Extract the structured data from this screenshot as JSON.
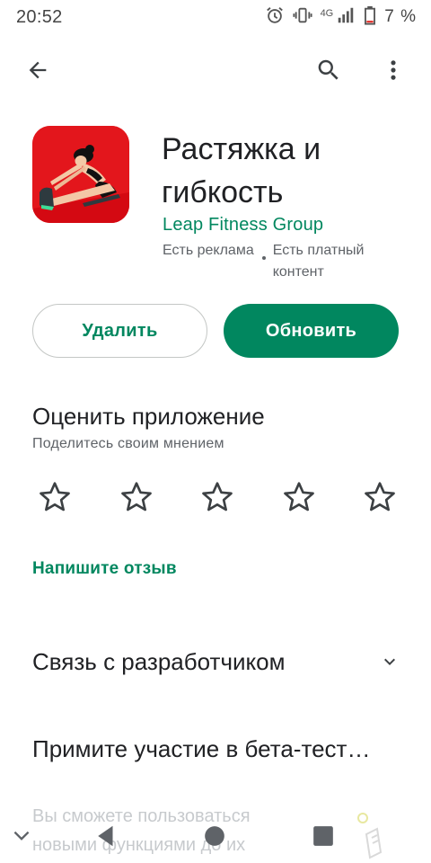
{
  "status_bar": {
    "time": "20:52",
    "network": "4G",
    "battery": "7 %"
  },
  "app_bar": {
    "back_icon": "arrow-left-icon",
    "search_icon": "search-icon",
    "more_icon": "more-vert-icon"
  },
  "app": {
    "title": "Растяжка и гибкость",
    "developer": "Leap Fitness Group",
    "meta_ads": "Есть реклама",
    "meta_iap": "Есть платный контент"
  },
  "buttons": {
    "uninstall": "Удалить",
    "update": "Обновить"
  },
  "rate": {
    "title": "Оценить приложение",
    "subtitle": "Поделитесь своим мнением",
    "star_count": 5,
    "write_review": "Напишите отзыв"
  },
  "contact": {
    "label": "Связь с разработчиком"
  },
  "beta": {
    "title": "Примите участие в бета-тест…",
    "description": "Вы сможете пользоваться новыми функциями до их"
  },
  "colors": {
    "accent": "#01875f",
    "icon_bg": "#e3161c"
  }
}
